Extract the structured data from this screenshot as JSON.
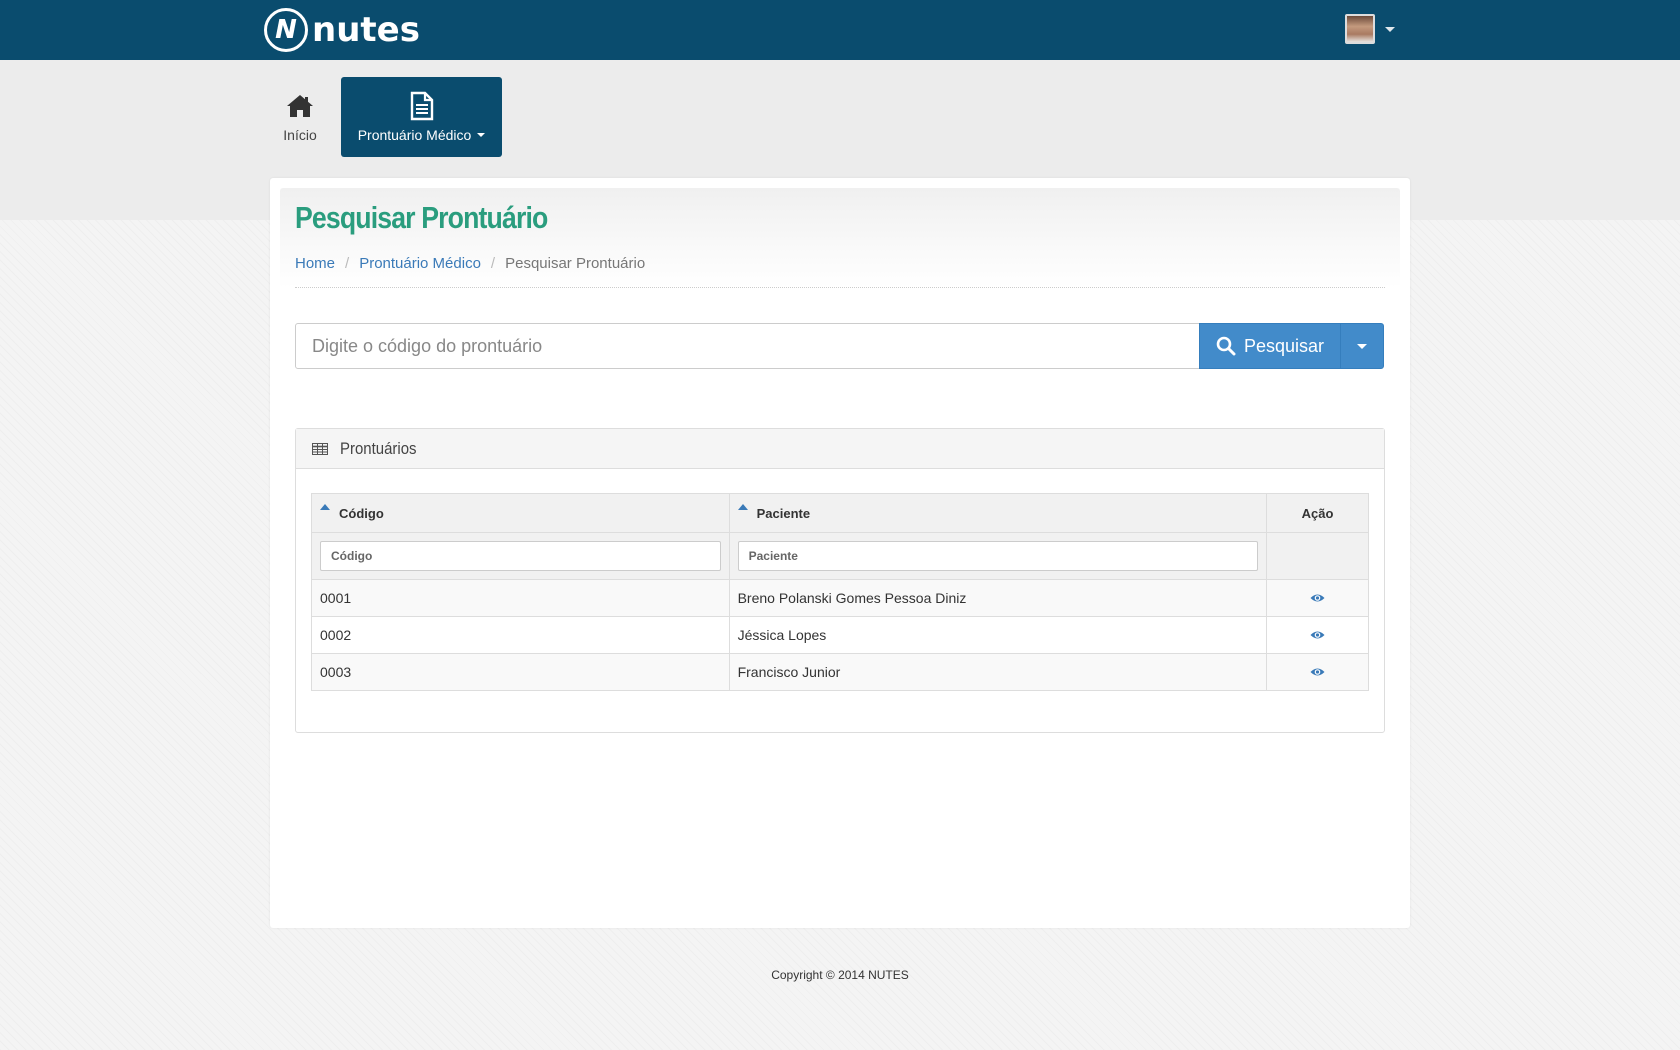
{
  "header": {
    "logo_text": "nutes",
    "logo_mark": "N"
  },
  "nav": {
    "items": [
      {
        "label": "Início",
        "icon": "home-icon"
      },
      {
        "label": "Prontuário Médico",
        "icon": "file-text-icon",
        "active": true,
        "has_dropdown": true
      }
    ]
  },
  "page": {
    "title": "Pesquisar Prontuário",
    "breadcrumb": [
      "Home",
      "Prontuário Médico",
      "Pesquisar Prontuário"
    ]
  },
  "search": {
    "placeholder": "Digite o código do prontuário",
    "button_label": "Pesquisar"
  },
  "panel": {
    "title": "Prontuários",
    "columns": [
      "Código",
      "Paciente",
      "Ação"
    ],
    "filters": [
      "Código",
      "Paciente"
    ],
    "rows": [
      {
        "codigo": "0001",
        "paciente": "Breno Polanski Gomes Pessoa Diniz"
      },
      {
        "codigo": "0002",
        "paciente": "Jéssica Lopes"
      },
      {
        "codigo": "0003",
        "paciente": "Francisco Junior"
      }
    ]
  },
  "footer": {
    "copyright": "Copyright © 2014 NUTES"
  },
  "colors": {
    "topbar": "#0a4c6e",
    "title": "#2a9d7e",
    "link": "#3a7ab8",
    "primary_button": "#428bca"
  }
}
